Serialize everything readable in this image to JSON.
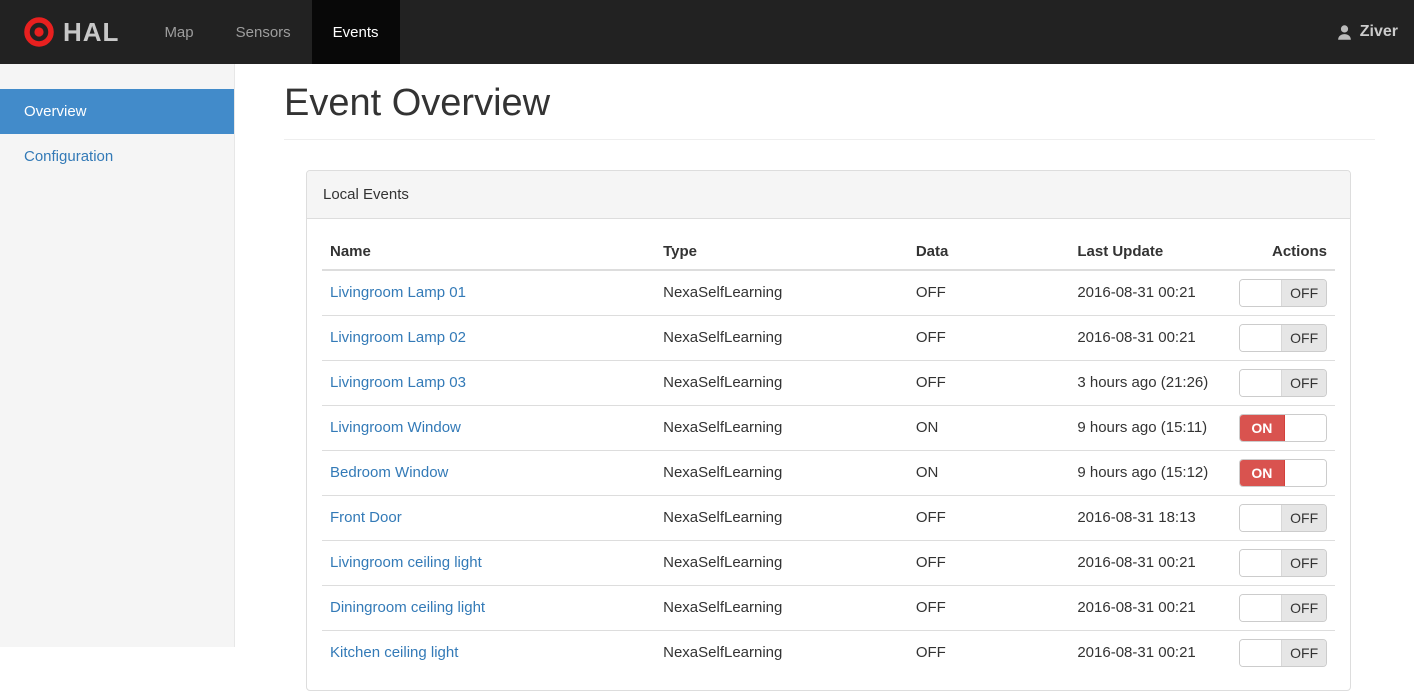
{
  "navbar": {
    "brand": "HAL",
    "items": [
      {
        "label": "Map",
        "active": false
      },
      {
        "label": "Sensors",
        "active": false
      },
      {
        "label": "Events",
        "active": true
      }
    ],
    "user": "Ziver"
  },
  "sidebar": {
    "items": [
      {
        "label": "Overview",
        "active": true
      },
      {
        "label": "Configuration",
        "active": false
      }
    ]
  },
  "main": {
    "title": "Event Overview",
    "panel": {
      "title": "Local Events",
      "table": {
        "columns": [
          "Name",
          "Type",
          "Data",
          "Last Update",
          "Actions"
        ],
        "rows": [
          {
            "name": "Livingroom Lamp 01",
            "type": "NexaSelfLearning",
            "data": "OFF",
            "last_update": "2016-08-31 00:21",
            "toggle_state": "OFF"
          },
          {
            "name": "Livingroom Lamp 02",
            "type": "NexaSelfLearning",
            "data": "OFF",
            "last_update": "2016-08-31 00:21",
            "toggle_state": "OFF"
          },
          {
            "name": "Livingroom Lamp 03",
            "type": "NexaSelfLearning",
            "data": "OFF",
            "last_update": "3 hours ago (21:26)",
            "toggle_state": "OFF"
          },
          {
            "name": "Livingroom Window",
            "type": "NexaSelfLearning",
            "data": "ON",
            "last_update": "9 hours ago (15:11)",
            "toggle_state": "ON"
          },
          {
            "name": "Bedroom Window",
            "type": "NexaSelfLearning",
            "data": "ON",
            "last_update": "9 hours ago (15:12)",
            "toggle_state": "ON"
          },
          {
            "name": "Front Door",
            "type": "NexaSelfLearning",
            "data": "OFF",
            "last_update": "2016-08-31 18:13",
            "toggle_state": "OFF"
          },
          {
            "name": "Livingroom ceiling light",
            "type": "NexaSelfLearning",
            "data": "OFF",
            "last_update": "2016-08-31 00:21",
            "toggle_state": "OFF"
          },
          {
            "name": "Diningroom ceiling light",
            "type": "NexaSelfLearning",
            "data": "OFF",
            "last_update": "2016-08-31 00:21",
            "toggle_state": "OFF"
          },
          {
            "name": "Kitchen ceiling light",
            "type": "NexaSelfLearning",
            "data": "OFF",
            "last_update": "2016-08-31 00:21",
            "toggle_state": "OFF"
          }
        ]
      }
    }
  },
  "colors": {
    "navbar_bg": "#222222",
    "navbar_active_bg": "#080808",
    "sidebar_bg": "#f5f5f5",
    "sidebar_active_bg": "#428bca",
    "link": "#337ab7",
    "toggle_on": "#d9534f",
    "toggle_off_label": "#e6e6e6",
    "logo_red": "#e8201f",
    "panel_border": "#dddddd"
  }
}
